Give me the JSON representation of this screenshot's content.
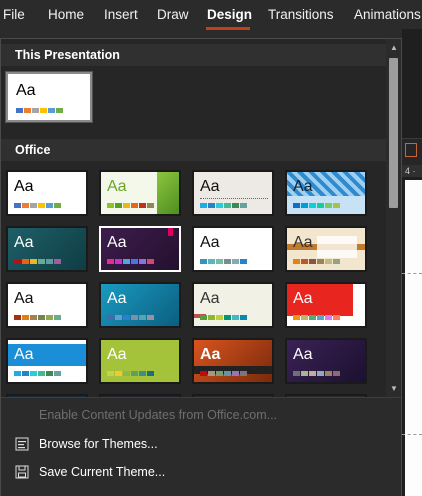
{
  "ribbon": {
    "tabs": [
      {
        "label": "File"
      },
      {
        "label": "Home"
      },
      {
        "label": "Insert"
      },
      {
        "label": "Draw"
      },
      {
        "label": "Design"
      },
      {
        "label": "Transitions"
      },
      {
        "label": "Animations"
      }
    ],
    "active_tab": "Design",
    "accent_color": "#c43e1c"
  },
  "background": {
    "ruler_text": "4 ·"
  },
  "panel": {
    "sections": [
      {
        "title": "This Presentation"
      },
      {
        "title": "Office"
      }
    ],
    "thumbnail_text": "Aa",
    "footer": {
      "enable_updates": "Enable Content Updates from Office.com...",
      "browse": "Browse for Themes...",
      "save": "Save Current Theme..."
    }
  }
}
